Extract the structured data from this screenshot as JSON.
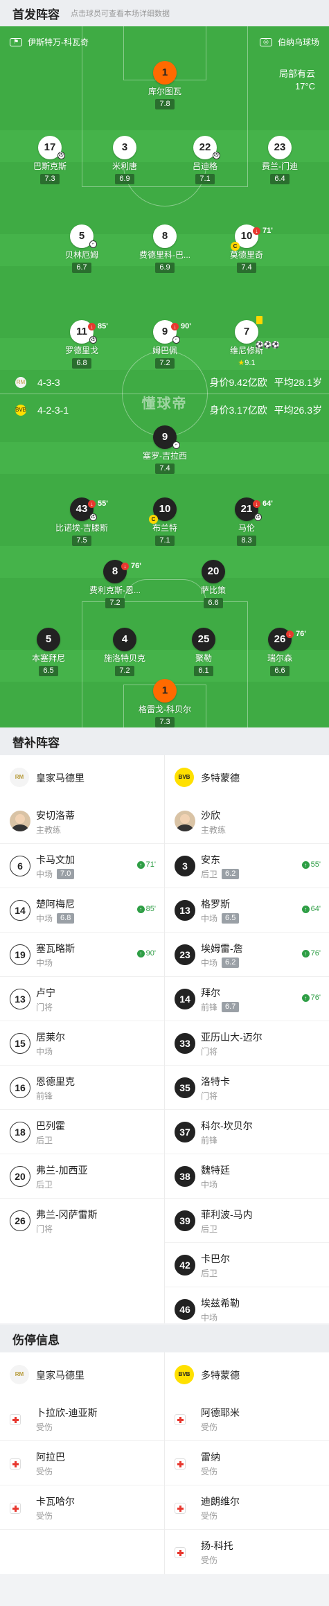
{
  "lineup_header": {
    "title": "首发阵容",
    "hint": "点击球员可查看本场详细数据"
  },
  "pitch": {
    "home_team": "伊斯特万-科瓦奇",
    "venue": "伯纳乌球场",
    "weather": "局部有云",
    "temperature": "17°C",
    "watermark": "懂球帝"
  },
  "home_formation": {
    "formation": "4-3-3",
    "value": "身价9.42亿欧",
    "age": "平均28.1岁"
  },
  "away_formation": {
    "formation": "4-2-3-1",
    "value": "身价3.17亿欧",
    "age": "平均26.3岁"
  },
  "home_players": [
    {
      "num": "1",
      "name": "库尔图瓦",
      "rating": "7.8"
    },
    {
      "num": "17",
      "name": "巴斯克斯",
      "rating": "7.3"
    },
    {
      "num": "3",
      "name": "米利唐",
      "rating": "6.9"
    },
    {
      "num": "22",
      "name": "吕迪格",
      "rating": "7.1"
    },
    {
      "num": "23",
      "name": "费兰-门迪",
      "rating": "6.4"
    },
    {
      "num": "5",
      "name": "贝林厄姆",
      "rating": "6.7"
    },
    {
      "num": "8",
      "name": "费德里科-巴...",
      "rating": "6.9"
    },
    {
      "num": "10",
      "name": "莫德里奇",
      "rating": "7.4",
      "sub": "71'"
    },
    {
      "num": "11",
      "name": "罗德里戈",
      "rating": "6.8",
      "sub": "85'"
    },
    {
      "num": "9",
      "name": "姆巴佩",
      "rating": "7.2",
      "sub": "90'"
    },
    {
      "num": "7",
      "name": "维尼修斯",
      "rating": "9.1"
    }
  ],
  "away_players": [
    {
      "num": "9",
      "name": "塞罗-吉拉西",
      "rating": "7.4"
    },
    {
      "num": "43",
      "name": "比诺埃-吉滕斯",
      "rating": "7.5",
      "sub": "55'"
    },
    {
      "num": "10",
      "name": "布兰特",
      "rating": "7.1"
    },
    {
      "num": "21",
      "name": "马伦",
      "rating": "8.3",
      "sub": "64'"
    },
    {
      "num": "8",
      "name": "费利克斯-恩...",
      "rating": "7.2",
      "sub": "76'"
    },
    {
      "num": "20",
      "name": "萨比策",
      "rating": "6.6"
    },
    {
      "num": "5",
      "name": "本塞拜尼",
      "rating": "6.5"
    },
    {
      "num": "4",
      "name": "施洛特贝克",
      "rating": "7.2"
    },
    {
      "num": "25",
      "name": "聚勒",
      "rating": "6.1"
    },
    {
      "num": "26",
      "name": "瑞尔森",
      "rating": "6.6",
      "sub": "76'"
    },
    {
      "num": "1",
      "name": "格雷戈-科贝尔",
      "rating": "7.3"
    }
  ],
  "subs_header": {
    "title": "替补阵容"
  },
  "home_team_name": "皇家马德里",
  "away_team_name": "多特蒙德",
  "home_logo": "RM",
  "away_logo": "BVB",
  "home_coach": {
    "name": "安切洛蒂",
    "role": "主教练"
  },
  "away_coach": {
    "name": "沙欣",
    "role": "主教练"
  },
  "home_subs": [
    {
      "num": "6",
      "name": "卡马文加",
      "pos": "中场",
      "rating": "7.0",
      "in": "71'"
    },
    {
      "num": "14",
      "name": "楚阿梅尼",
      "pos": "中场",
      "rating": "6.8",
      "in": "85'"
    },
    {
      "num": "19",
      "name": "塞瓦略斯",
      "pos": "中场",
      "in": "90'"
    },
    {
      "num": "13",
      "name": "卢宁",
      "pos": "门将"
    },
    {
      "num": "15",
      "name": "居莱尔",
      "pos": "中场"
    },
    {
      "num": "16",
      "name": "恩德里克",
      "pos": "前锋"
    },
    {
      "num": "18",
      "name": "巴列霍",
      "pos": "后卫"
    },
    {
      "num": "20",
      "name": "弗兰-加西亚",
      "pos": "后卫"
    },
    {
      "num": "26",
      "name": "弗兰-冈萨雷斯",
      "pos": "门将"
    }
  ],
  "away_subs": [
    {
      "num": "3",
      "name": "安东",
      "pos": "后卫",
      "rating": "6.2",
      "in": "55'"
    },
    {
      "num": "13",
      "name": "格罗斯",
      "pos": "中场",
      "rating": "6.5",
      "in": "64'"
    },
    {
      "num": "23",
      "name": "埃姆雷-詹",
      "pos": "中场",
      "rating": "6.2",
      "in": "76'"
    },
    {
      "num": "14",
      "name": "拜尔",
      "pos": "前锋",
      "rating": "6.7",
      "in": "76'"
    },
    {
      "num": "33",
      "name": "亚历山大-迈尔",
      "pos": "门将"
    },
    {
      "num": "35",
      "name": "洛特卡",
      "pos": "门将"
    },
    {
      "num": "37",
      "name": "科尔-坎贝尔",
      "pos": "前锋"
    },
    {
      "num": "38",
      "name": "魏特廷",
      "pos": "中场"
    },
    {
      "num": "39",
      "name": "菲利波-马内",
      "pos": "后卫"
    },
    {
      "num": "42",
      "name": "卡巴尔",
      "pos": "后卫"
    },
    {
      "num": "46",
      "name": "埃兹希勒",
      "pos": "中场"
    }
  ],
  "injury_header": {
    "title": "伤停信息"
  },
  "home_injuries": [
    {
      "name": "卜拉欣-迪亚斯",
      "status": "受伤"
    },
    {
      "name": "阿拉巴",
      "status": "受伤"
    },
    {
      "name": "卡瓦哈尔",
      "status": "受伤"
    }
  ],
  "away_injuries": [
    {
      "name": "阿德耶米",
      "status": "受伤"
    },
    {
      "name": "雷纳",
      "status": "受伤"
    },
    {
      "name": "迪朗维尔",
      "status": "受伤"
    },
    {
      "name": "扬-科托",
      "status": "受伤"
    }
  ],
  "colors": {
    "pitch": "#3fab44",
    "sub_in": "#2e9e45",
    "gk": "#ff6a00",
    "captain": "#ffd600"
  }
}
